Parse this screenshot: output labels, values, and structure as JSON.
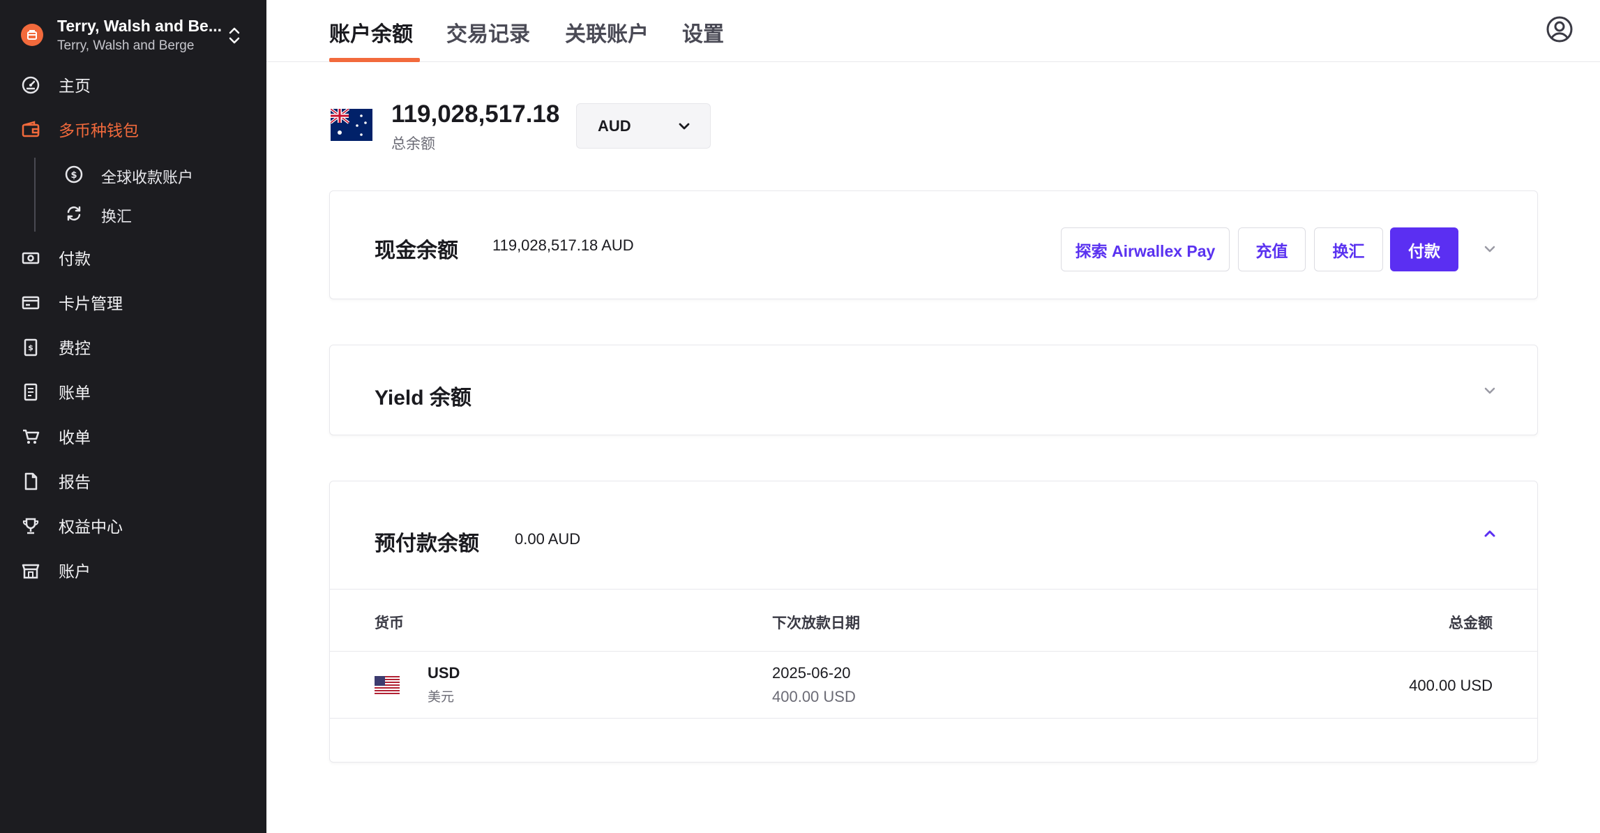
{
  "org": {
    "name": "Terry, Walsh and Be...",
    "subtitle": "Terry, Walsh and Berge"
  },
  "sidebar": {
    "items": [
      {
        "label": "主页",
        "icon": "dashboard-icon"
      },
      {
        "label": "多币种钱包",
        "icon": "wallet-icon",
        "active": true
      },
      {
        "label": "付款",
        "icon": "payment-icon"
      },
      {
        "label": "卡片管理",
        "icon": "card-icon"
      },
      {
        "label": "费控",
        "icon": "expense-icon"
      },
      {
        "label": "账单",
        "icon": "bill-icon"
      },
      {
        "label": "收单",
        "icon": "cart-icon"
      },
      {
        "label": "报告",
        "icon": "report-icon"
      },
      {
        "label": "权益中心",
        "icon": "trophy-icon"
      },
      {
        "label": "账户",
        "icon": "store-icon"
      }
    ],
    "subitems": [
      {
        "label": "全球收款账户",
        "icon": "dollar-circle-icon"
      },
      {
        "label": "换汇",
        "icon": "refresh-icon"
      }
    ]
  },
  "tabs": [
    "账户余额",
    "交易记录",
    "关联账户",
    "设置"
  ],
  "balance": {
    "total": "119,028,517.18",
    "label": "总余额",
    "currency": "AUD"
  },
  "cash": {
    "title": "现金余额",
    "amount": "119,028,517.18 AUD",
    "buttons": {
      "explore": "探索 Airwallex Pay",
      "deposit": "充值",
      "exchange": "换汇",
      "pay": "付款"
    }
  },
  "yield": {
    "title": "Yield 余额"
  },
  "prepaid": {
    "title": "预付款余额",
    "amount": "0.00 AUD",
    "columns": [
      "货币",
      "下次放款日期",
      "总金额"
    ],
    "rows": [
      {
        "code": "USD",
        "name": "美元",
        "date": "2025-06-20",
        "date_amount": "400.00 USD",
        "total": "400.00 USD"
      }
    ]
  },
  "colors": {
    "accent": "#f26a3c",
    "primary": "#5b2ff2",
    "sidebar_bg": "#1c1c20"
  }
}
